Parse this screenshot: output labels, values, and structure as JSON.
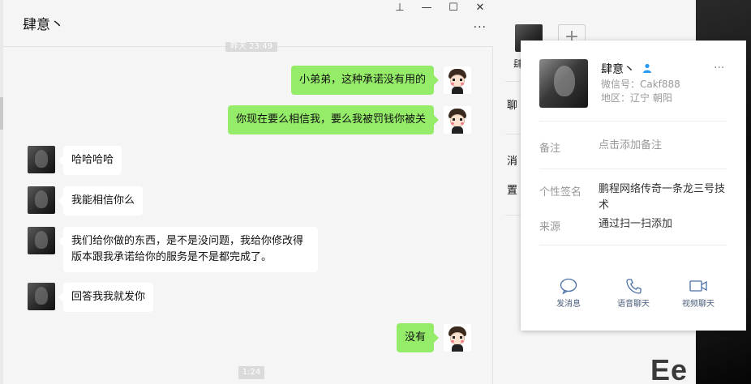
{
  "chat": {
    "title": "肆意丶",
    "timestamp_top": "昨天 23:49",
    "timestamp_bottom": "1:24",
    "messages": [
      {
        "from": "me",
        "text": "小弟弟，这种承诺没有用的"
      },
      {
        "from": "me",
        "text": "你现在要么相信我，要么我被罚钱你被关"
      },
      {
        "from": "them",
        "text": "哈哈哈哈"
      },
      {
        "from": "them",
        "text": "我能相信你么"
      },
      {
        "from": "them",
        "text": "我们给你做的东西，是不是没问题，我给你修改得版本跟我承诺给你的服务是不是都完成了。"
      },
      {
        "from": "them",
        "text": "回答我我就发你"
      },
      {
        "from": "me",
        "text": "没有"
      }
    ],
    "more_label": "···"
  },
  "window_controls": {
    "pin": "⊥",
    "minimize": "—",
    "maximize": "☐",
    "close": "✕"
  },
  "mid_panel": {
    "add_label": "+",
    "name_partial": "肆",
    "row1": "聊",
    "row2": "消",
    "row3": "置"
  },
  "profile_card": {
    "name": "肆意丶",
    "wechat_id": "微信号：Cakf888",
    "region": "地区：辽宁 朝阳",
    "remark_key": "备注",
    "remark_value": "点击添加备注",
    "signature_key": "个性签名",
    "signature_value": "鹏程网络传奇一条龙三号技术",
    "source_key": "来源",
    "source_value": "通过扫一扫添加",
    "more_label": "···",
    "actions": [
      {
        "label": "发消息",
        "icon": "message-icon"
      },
      {
        "label": "语音聊天",
        "icon": "phone-icon"
      },
      {
        "label": "视频聊天",
        "icon": "video-icon"
      }
    ]
  },
  "background_text": "Ee"
}
